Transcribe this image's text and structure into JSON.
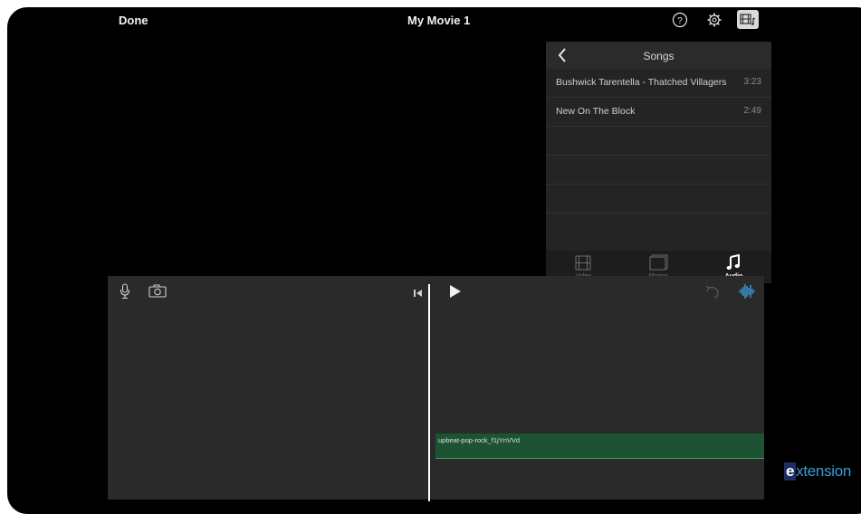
{
  "topbar": {
    "done_label": "Done",
    "title": "My Movie 1",
    "help_icon": "question-circle-icon",
    "settings_icon": "gear-icon",
    "media_icon": "film-music-icon"
  },
  "songs_panel": {
    "title": "Songs",
    "back_icon": "chevron-left-icon",
    "songs": [
      {
        "title": "Bushwick Tarentella - Thatched Villagers",
        "duration": "3:23"
      },
      {
        "title": "New On The Block",
        "duration": "2:49"
      }
    ],
    "tabs": [
      {
        "label": "Video",
        "icon": "film-icon",
        "active": false
      },
      {
        "label": "Photos",
        "icon": "photo-icon",
        "active": false
      },
      {
        "label": "Audio",
        "icon": "music-note-icon",
        "active": true
      }
    ]
  },
  "timeline": {
    "mic_icon": "microphone-icon",
    "camera_icon": "camera-icon",
    "skip_back_icon": "skip-to-start-icon",
    "play_icon": "play-icon",
    "undo_icon": "undo-icon",
    "waveform_icon": "audio-waveform-icon",
    "clip_label": "upbeat-pop-rock_f1jYnVVd"
  },
  "watermark": {
    "prefix": "e",
    "rest": "xtension"
  },
  "colors": {
    "clip": "#1d5233",
    "accent": "#3a9bd5"
  }
}
